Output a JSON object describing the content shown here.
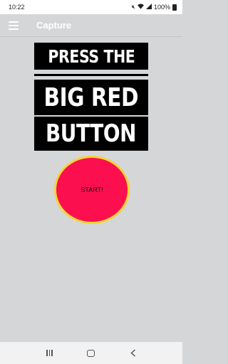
{
  "status_bar": {
    "time": "10:22",
    "battery_percent": "100%",
    "icons": [
      "mute-icon",
      "wifi-icon",
      "signal-icon",
      "battery-icon"
    ]
  },
  "app_bar": {
    "title": "Capture",
    "menu_icon": "hamburger-menu-icon"
  },
  "headline": {
    "line1": "PRESS THE",
    "line2": "BIG RED",
    "line3": "BUTTON"
  },
  "button": {
    "label": "START!",
    "fill_color": "#fb0f4e",
    "border_color": "#f3d437"
  },
  "nav_bar": {
    "icons": [
      "recents-icon",
      "home-icon",
      "back-icon"
    ]
  }
}
